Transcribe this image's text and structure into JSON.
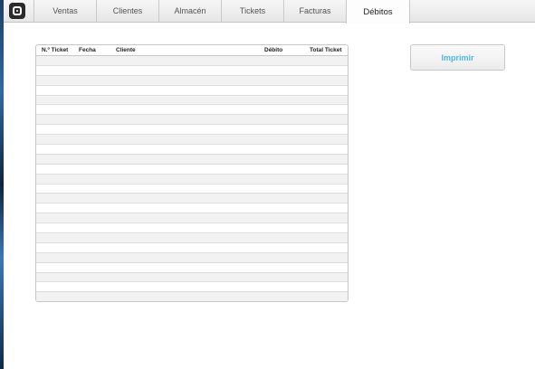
{
  "tabs": [
    {
      "label": "Ventas"
    },
    {
      "label": "Clientes"
    },
    {
      "label": "Almacén"
    },
    {
      "label": "Tickets"
    },
    {
      "label": "Facturas"
    },
    {
      "label": "Débitos",
      "active": true
    }
  ],
  "table": {
    "columns": [
      "N.º Ticket",
      "Fecha",
      "Cliente",
      "Débito",
      "Total Ticket"
    ],
    "rows": []
  },
  "actions": {
    "print_label": "Imprimir"
  },
  "colors": {
    "accent": "#4fb6e8"
  }
}
